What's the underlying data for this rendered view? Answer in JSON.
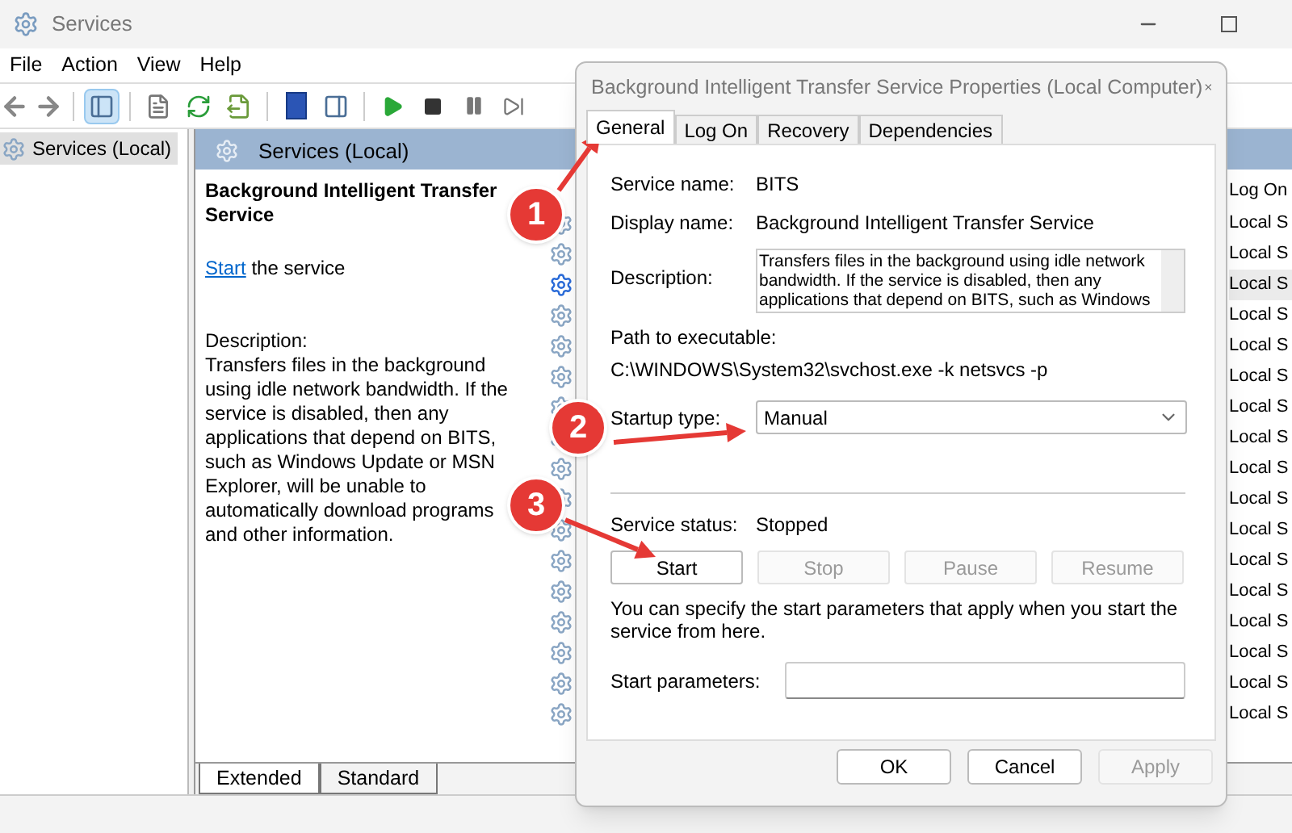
{
  "window": {
    "title": "Services"
  },
  "menu": [
    "File",
    "Action",
    "View",
    "Help"
  ],
  "tree": [
    {
      "label": "Services (Local)",
      "selected": true
    }
  ],
  "details": {
    "header": "Services (Local)",
    "service_title": "Background Intelligent Transfer Service",
    "action_link": "Start",
    "action_text": "the service",
    "description_label": "Description:",
    "description": "Transfers files in the background using idle network bandwidth. If the service is disabled, then any applications that depend on BITS, such as Windows Update or MSN Explorer, will be unable to automatically download programs and other information."
  },
  "list": {
    "column": "Log On",
    "rows": [
      {
        "log_on": "Local S",
        "selected": false
      },
      {
        "log_on": "Local S",
        "selected": false
      },
      {
        "log_on": "Local S",
        "selected": true
      },
      {
        "log_on": "Local S",
        "selected": false
      },
      {
        "log_on": "Local S",
        "selected": false
      },
      {
        "log_on": "Local S",
        "selected": false
      },
      {
        "log_on": "Local S",
        "selected": false
      },
      {
        "log_on": "Local S",
        "selected": false
      },
      {
        "log_on": "Local S",
        "selected": false
      },
      {
        "log_on": "Local S",
        "selected": false
      },
      {
        "log_on": "Local S",
        "selected": false
      },
      {
        "log_on": "Local S",
        "selected": false
      },
      {
        "log_on": "Local S",
        "selected": false
      },
      {
        "log_on": "Local S",
        "selected": false
      },
      {
        "log_on": "Local S",
        "selected": false
      },
      {
        "log_on": "Local S",
        "selected": false
      },
      {
        "log_on": "Local S",
        "selected": false
      }
    ]
  },
  "view_tabs": [
    {
      "label": "Extended",
      "selected": true
    },
    {
      "label": "Standard",
      "selected": false
    }
  ],
  "dialog": {
    "title": "Background Intelligent Transfer Service Properties (Local Computer)",
    "tabs": [
      {
        "label": "General",
        "selected": true
      },
      {
        "label": "Log On",
        "selected": false
      },
      {
        "label": "Recovery",
        "selected": false
      },
      {
        "label": "Dependencies",
        "selected": false
      }
    ],
    "service_name_label": "Service name:",
    "service_name": "BITS",
    "display_name_label": "Display name:",
    "display_name": "Background Intelligent Transfer Service",
    "description_label": "Description:",
    "description": "Transfers files in the background using idle network bandwidth. If the service is disabled, then any applications that depend on BITS, such as Windows",
    "path_label": "Path to executable:",
    "path": "C:\\WINDOWS\\System32\\svchost.exe -k netsvcs -p",
    "startup_type_label": "Startup type:",
    "startup_type": "Manual",
    "status_label": "Service status:",
    "status": "Stopped",
    "control_buttons": [
      {
        "label": "Start",
        "disabled": false
      },
      {
        "label": "Stop",
        "disabled": true
      },
      {
        "label": "Pause",
        "disabled": true
      },
      {
        "label": "Resume",
        "disabled": true
      }
    ],
    "hint": "You can specify the start parameters that apply when you start the service from here.",
    "start_params_label": "Start parameters:",
    "footer_buttons": [
      {
        "label": "OK",
        "disabled": false
      },
      {
        "label": "Cancel",
        "disabled": false
      },
      {
        "label": "Apply",
        "disabled": true
      }
    ]
  },
  "annotations": [
    "1",
    "2",
    "3"
  ]
}
